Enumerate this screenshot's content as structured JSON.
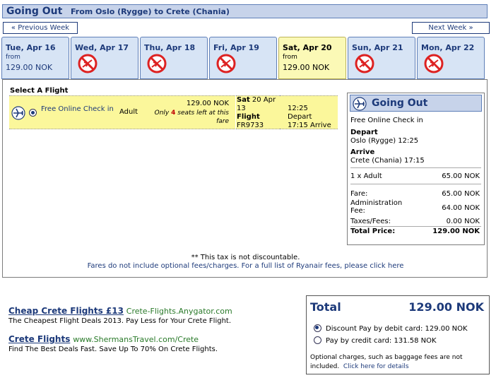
{
  "header": {
    "title": "Going Out",
    "route": "From Oslo (Rygge) to Crete (Chania)"
  },
  "nav": {
    "prev": "« Previous Week",
    "next": "Next Week »"
  },
  "days": [
    {
      "label": "Tue, Apr 16",
      "from": "from",
      "price": "129.00 NOK",
      "available": true
    },
    {
      "label": "Wed, Apr 17",
      "available": false
    },
    {
      "label": "Thu, Apr 18",
      "available": false
    },
    {
      "label": "Fri, Apr 19",
      "available": false
    },
    {
      "label": "Sat, Apr 20",
      "from": "from",
      "price": "129.00 NOK",
      "available": true,
      "selected": true
    },
    {
      "label": "Sun, Apr 21",
      "available": false
    },
    {
      "label": "Mon, Apr 22",
      "available": false
    }
  ],
  "select_label": "Select A Flight",
  "flight": {
    "checkin": "Free Online Check in",
    "passenger": "Adult",
    "price": "129.00 NOK",
    "seats_prefix": "Only",
    "seats_count": "4",
    "seats_suffix": "seats left at this fare",
    "day": "Sat",
    "date": "20 Apr 13",
    "flight_label": "Flight",
    "flight_no": "FR9733",
    "dep_time": "12:25",
    "dep_label": "Depart",
    "arr_time": "17:15",
    "arr_label": "Arrive"
  },
  "summary": {
    "title": "Going Out",
    "checkin": "Free Online Check in",
    "depart_label": "Depart",
    "depart_value": "Oslo (Rygge) 12:25",
    "arrive_label": "Arrive",
    "arrive_value": "Crete (Chania) 17:15",
    "adult_label": "1 x Adult",
    "adult_value": "65.00 NOK",
    "fare_label": "Fare:",
    "fare_value": "65.00 NOK",
    "admin_label1": "Administration",
    "admin_label2": "Fee:",
    "admin_value": "64.00 NOK",
    "taxes_label": "Taxes/Fees:",
    "taxes_value": "0.00 NOK",
    "total_label": "Total Price:",
    "total_value": "129.00 NOK"
  },
  "notes": {
    "tax": "** This tax is not discountable.",
    "fees": "Fares do not include optional fees/charges. For a full list of Ryanair fees, please click here"
  },
  "ads": [
    {
      "title": "Cheap Crete Flights £13",
      "url": "Crete-Flights.Anygator.com",
      "desc": "The Cheapest Flight Deals 2013. Pay Less for Your Crete Flight."
    },
    {
      "title": "Crete Flights",
      "url": "www.ShermansTravel.com/Crete",
      "desc": "Find The Best Deals Fast. Save Up To 70% On Crete Flights."
    }
  ],
  "total": {
    "label": "Total",
    "amount": "129.00 NOK",
    "debit": "Discount Pay by debit card: 129.00 NOK",
    "credit": "Pay by credit card: 131.58 NOK",
    "optional_text": "Optional charges, such as baggage fees are not included.",
    "optional_link": "Click here for details"
  },
  "colors": {
    "accent": "#1d3a7a",
    "header_bg": "#c7d3ea",
    "selected_bg": "#fbf79b"
  }
}
